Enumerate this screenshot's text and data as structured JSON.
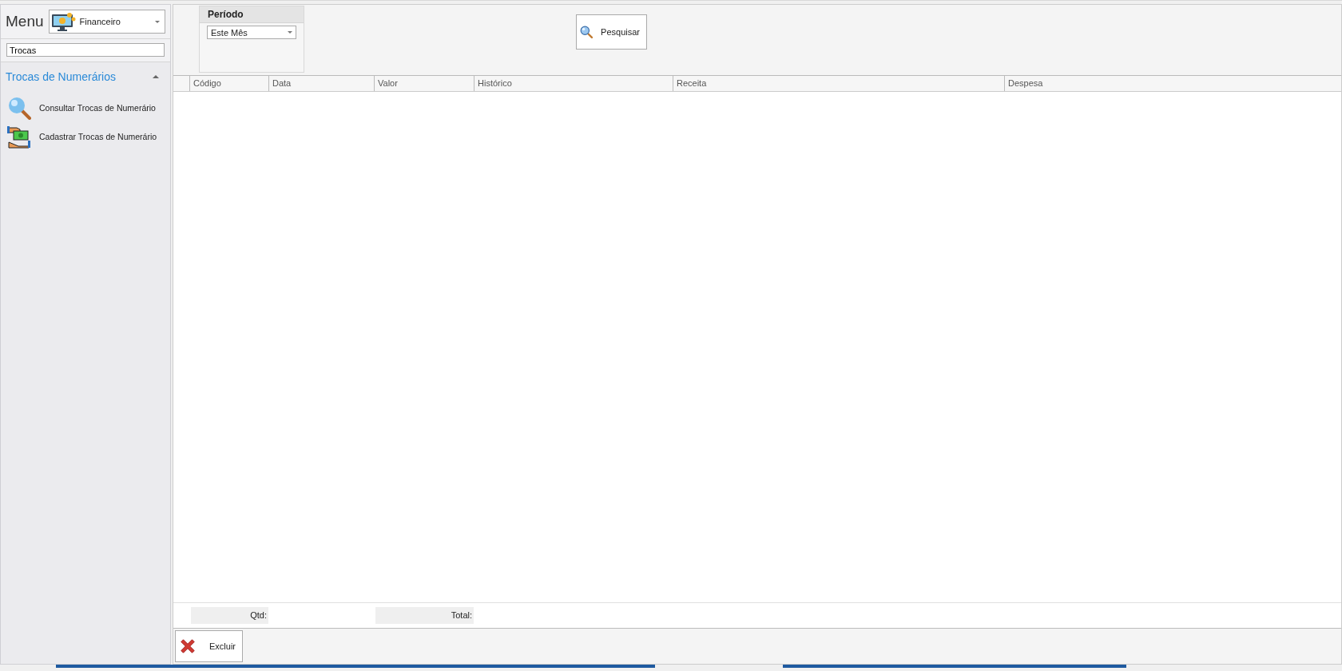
{
  "sidebar": {
    "title": "Menu",
    "module": {
      "label": "Financeiro"
    },
    "search": {
      "value": "Trocas"
    },
    "section": {
      "title": "Trocas de Numerários",
      "expanded": true
    },
    "items": [
      {
        "label": "Consultar Trocas de Numerário",
        "kind": "search"
      },
      {
        "label": "Cadastrar Trocas de Numerário",
        "kind": "money"
      }
    ]
  },
  "filter": {
    "title": "Período",
    "period": {
      "value": "Este Mês"
    }
  },
  "search_button": {
    "label": "Pesquisar"
  },
  "table": {
    "columns": [
      "Código",
      "Data",
      "Valor",
      "Histórico",
      "Receita",
      "Despesa"
    ]
  },
  "summary": [
    {
      "label": "Qtd:"
    },
    {
      "label": "Total:"
    }
  ],
  "actions": [
    {
      "label": "Excluir",
      "kind": "delete"
    }
  ]
}
